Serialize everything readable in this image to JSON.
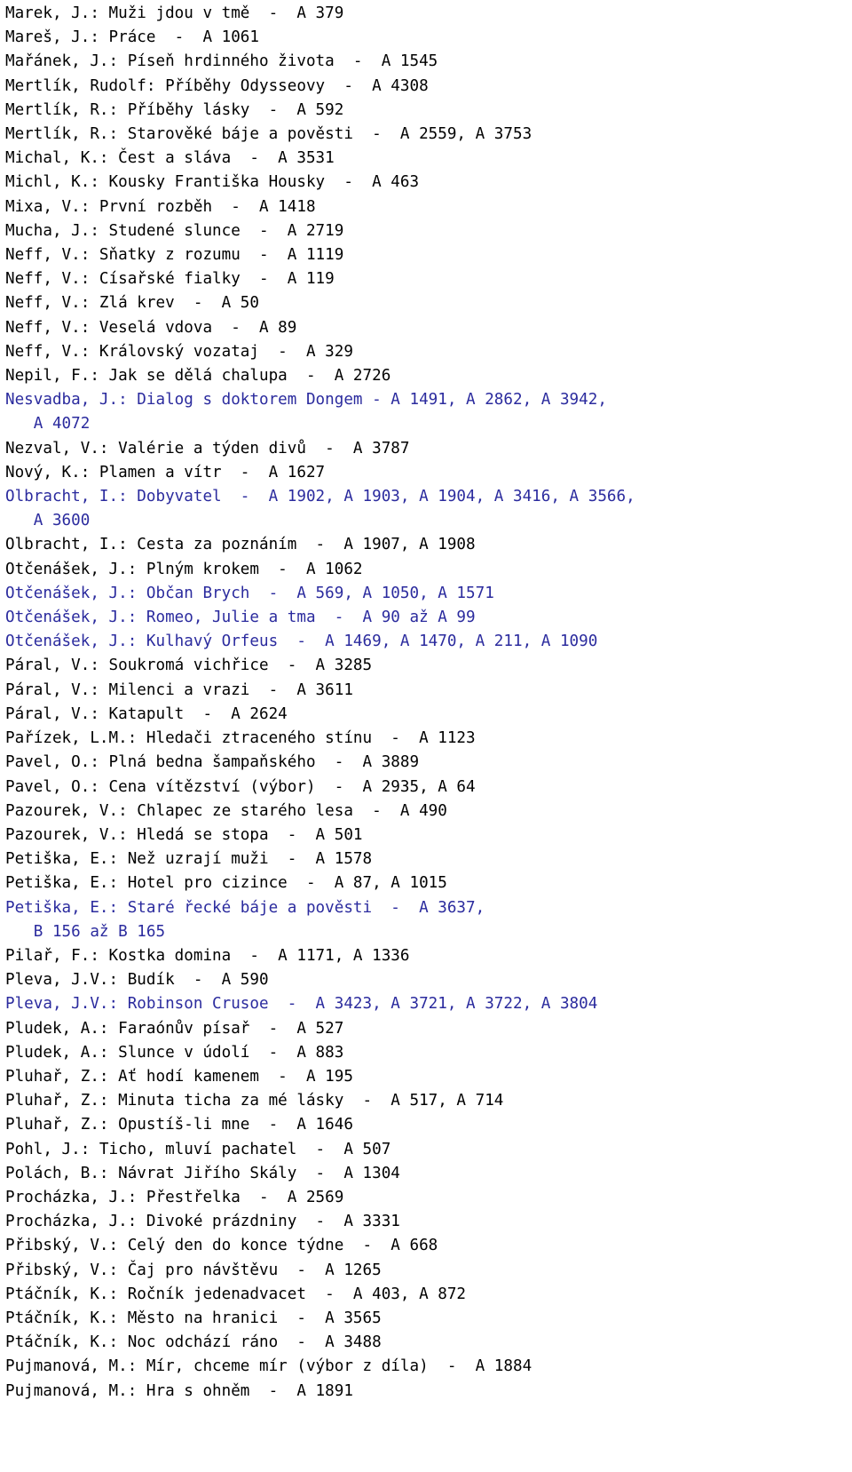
{
  "document": {
    "kind": "library-catalog-listing",
    "language": "cs",
    "colors": {
      "text": "#000000",
      "link": "#2b2b9e",
      "background": "#ffffff"
    },
    "continuation_indent": "   ",
    "entries": [
      {
        "text": "Marek, J.: Muži jdou v tmě  -  A 379",
        "link": false
      },
      {
        "text": "Mareš, J.: Práce  -  A 1061",
        "link": false
      },
      {
        "text": "Mařánek, J.: Píseň hrdinného života  -  A 1545",
        "link": false
      },
      {
        "text": "Mertlík, Rudolf: Příběhy Odysseovy  -  A 4308",
        "link": false
      },
      {
        "text": "Mertlík, R.: Příběhy lásky  -  A 592",
        "link": false
      },
      {
        "text": "Mertlík, R.: Starověké báje a pověsti  -  A 2559, A 3753",
        "link": false
      },
      {
        "text": "Michal, K.: Čest a sláva  -  A 3531",
        "link": false
      },
      {
        "text": "Michl, K.: Kousky Františka Housky  -  A 463",
        "link": false
      },
      {
        "text": "Mixa, V.: První rozběh  -  A 1418",
        "link": false
      },
      {
        "text": "Mucha, J.: Studené slunce  -  A 2719",
        "link": false
      },
      {
        "text": "Neff, V.: Sňatky z rozumu  -  A 1119",
        "link": false
      },
      {
        "text": "Neff, V.: Císařské fialky  -  A 119",
        "link": false
      },
      {
        "text": "Neff, V.: Zlá krev  -  A 50",
        "link": false
      },
      {
        "text": "Neff, V.: Veselá vdova  -  A 89",
        "link": false
      },
      {
        "text": "Neff, V.: Královský vozataj  -  A 329",
        "link": false
      },
      {
        "text": "Nepil, F.: Jak se dělá chalupa  -  A 2726",
        "link": false
      },
      {
        "text": "Nesvadba, J.: Dialog s doktorem Dongem - A 1491, A 2862, A 3942,",
        "link": true,
        "continuation": "A 4072"
      },
      {
        "text": "Nezval, V.: Valérie a týden divů  -  A 3787",
        "link": false
      },
      {
        "text": "Nový, K.: Plamen a vítr  -  A 1627",
        "link": false
      },
      {
        "text": "Olbracht, I.: Dobyvatel  -  A 1902, A 1903, A 1904, A 3416, A 3566,",
        "link": true,
        "continuation": "A 3600"
      },
      {
        "text": "Olbracht, I.: Cesta za poznáním  -  A 1907, A 1908",
        "link": false
      },
      {
        "text": "Otčenášek, J.: Plným krokem  -  A 1062",
        "link": false
      },
      {
        "text": "Otčenášek, J.: Občan Brych  -  A 569, A 1050, A 1571",
        "link": true
      },
      {
        "text": "Otčenášek, J.: Romeo, Julie a tma  -  A 90 až A 99",
        "link": true
      },
      {
        "text": "Otčenášek, J.: Kulhavý Orfeus  -  A 1469, A 1470, A 211, A 1090",
        "link": true
      },
      {
        "text": "Páral, V.: Soukromá vichřice  -  A 3285",
        "link": false
      },
      {
        "text": "Páral, V.: Milenci a vrazi  -  A 3611",
        "link": false
      },
      {
        "text": "Páral, V.: Katapult  -  A 2624",
        "link": false
      },
      {
        "text": "Pařízek, L.M.: Hledači ztraceného stínu  -  A 1123",
        "link": false
      },
      {
        "text": "Pavel, O.: Plná bedna šampaňského  -  A 3889",
        "link": false
      },
      {
        "text": "Pavel, O.: Cena vítězství (výbor)  -  A 2935, A 64",
        "link": false
      },
      {
        "text": "Pazourek, V.: Chlapec ze starého lesa  -  A 490",
        "link": false
      },
      {
        "text": "Pazourek, V.: Hledá se stopa  -  A 501",
        "link": false
      },
      {
        "text": "Petiška, E.: Než uzrají muži  -  A 1578",
        "link": false
      },
      {
        "text": "Petiška, E.: Hotel pro cizince  -  A 87, A 1015",
        "link": false
      },
      {
        "text": "Petiška, E.: Staré řecké báje a pověsti  -  A 3637,",
        "link": true,
        "continuation": "B 156 až B 165"
      },
      {
        "text": "Pilař, F.: Kostka domina  -  A 1171, A 1336",
        "link": false
      },
      {
        "text": "Pleva, J.V.: Budík  -  A 590",
        "link": false
      },
      {
        "text": "Pleva, J.V.: Robinson Crusoe  -  A 3423, A 3721, A 3722, A 3804",
        "link": true
      },
      {
        "text": "Pludek, A.: Faraónův písař  -  A 527",
        "link": false
      },
      {
        "text": "Pludek, A.: Slunce v údolí  -  A 883",
        "link": false
      },
      {
        "text": "Pluhař, Z.: Ať hodí kamenem  -  A 195",
        "link": false
      },
      {
        "text": "Pluhař, Z.: Minuta ticha za mé lásky  -  A 517, A 714",
        "link": false
      },
      {
        "text": "Pluhař, Z.: Opustíš-li mne  -  A 1646",
        "link": false
      },
      {
        "text": "Pohl, J.: Ticho, mluví pachatel  -  A 507",
        "link": false
      },
      {
        "text": "Polách, B.: Návrat Jiřího Skály  -  A 1304",
        "link": false
      },
      {
        "text": "Procházka, J.: Přestřelka  -  A 2569",
        "link": false
      },
      {
        "text": "Procházka, J.: Divoké prázdniny  -  A 3331",
        "link": false
      },
      {
        "text": "Přibský, V.: Celý den do konce týdne  -  A 668",
        "link": false
      },
      {
        "text": "Přibský, V.: Čaj pro návštěvu  -  A 1265",
        "link": false
      },
      {
        "text": "Ptáčník, K.: Ročník jedenadvacet  -  A 403, A 872",
        "link": false
      },
      {
        "text": "Ptáčník, K.: Město na hranici  -  A 3565",
        "link": false
      },
      {
        "text": "Ptáčník, K.: Noc odchází ráno  -  A 3488",
        "link": false
      },
      {
        "text": "Pujmanová, M.: Mír, chceme mír (výbor z díla)  -  A 1884",
        "link": false
      },
      {
        "text": "Pujmanová, M.: Hra s ohněm  -  A 1891",
        "link": false
      }
    ]
  }
}
